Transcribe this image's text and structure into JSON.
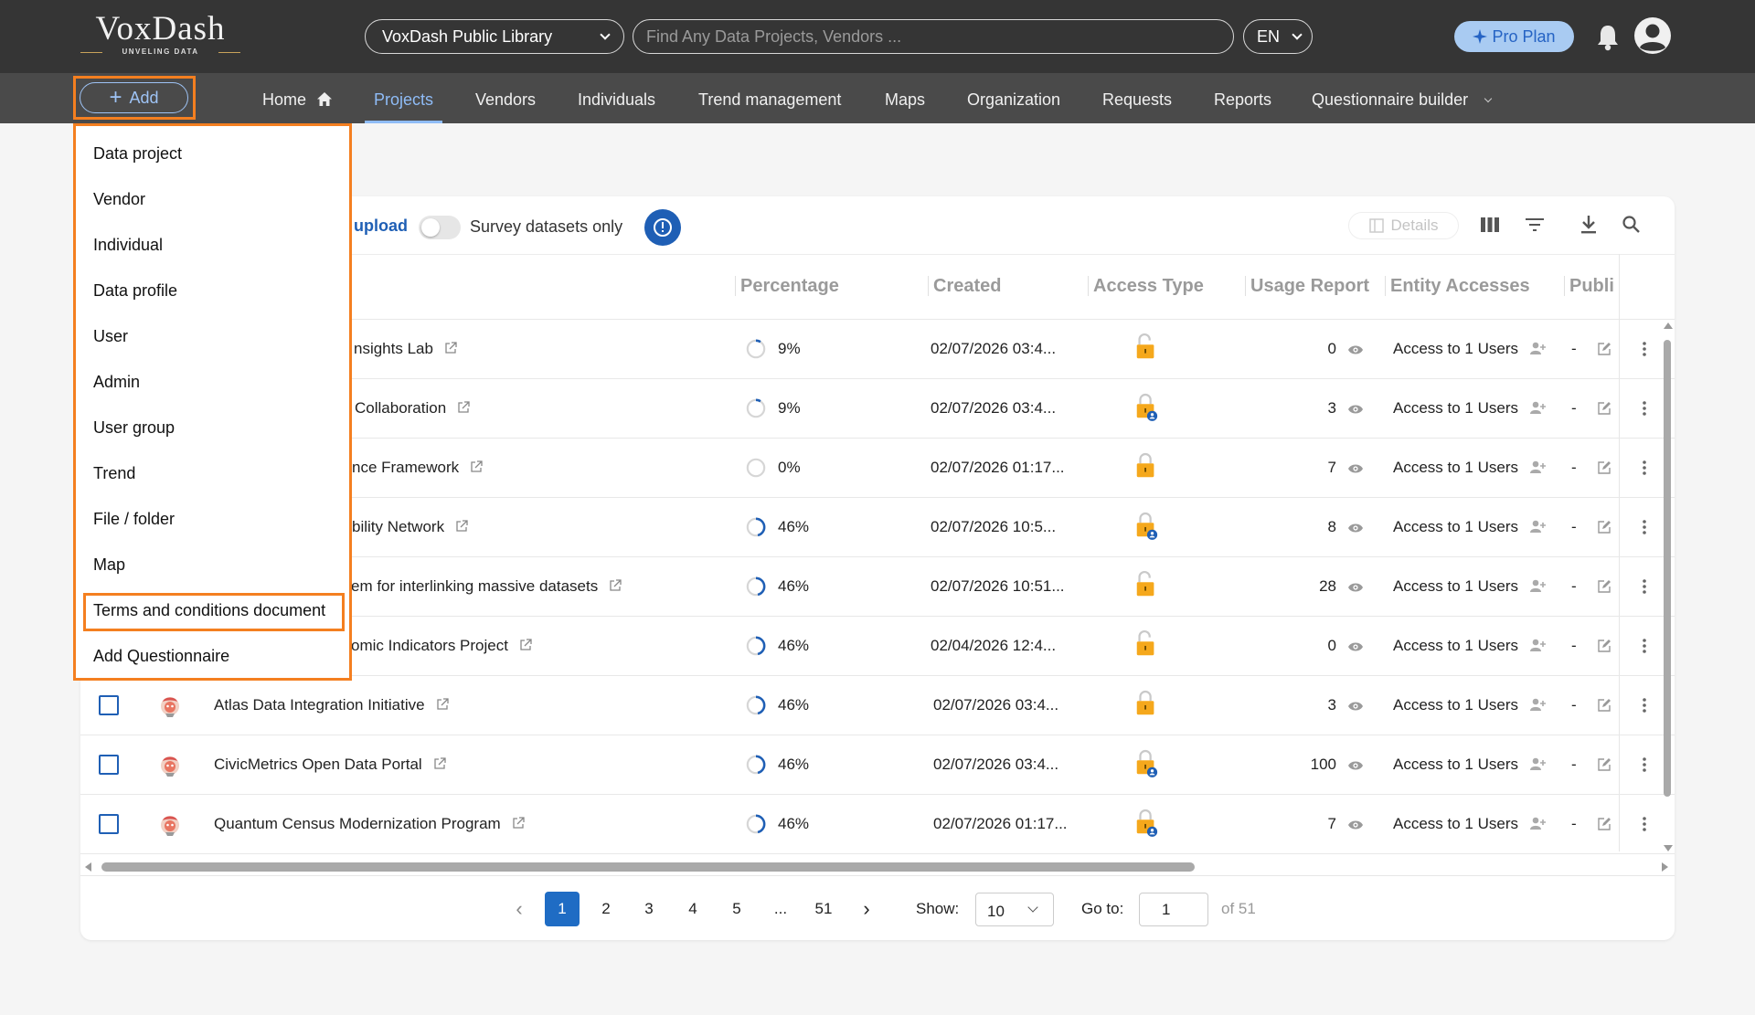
{
  "header": {
    "logo_text": "VoxDash",
    "logo_tagline": "UNVELING DATA",
    "library_select": "VoxDash Public Library",
    "search_placeholder": "Find Any Data Projects, Vendors ...",
    "language": "EN",
    "pro_plan": "Pro Plan"
  },
  "nav": {
    "add_label": "Add",
    "items": [
      "Home",
      "Projects",
      "Vendors",
      "Individuals",
      "Trend management",
      "Maps",
      "Organization",
      "Requests",
      "Reports",
      "Questionnaire builder"
    ],
    "active": "Projects"
  },
  "toolbar": {
    "upload_label": "upload",
    "survey_toggle_label": "Survey datasets only",
    "details_label": "Details"
  },
  "table": {
    "columns": [
      "Percentage",
      "Created",
      "Access Type",
      "Usage Report",
      "Entity Accesses",
      "Publi"
    ],
    "rows": [
      {
        "name": "nsights Lab",
        "percent": "9%",
        "progress": 0.09,
        "created": "02/07/2026 03:4...",
        "access": "unlocked",
        "usage": "0",
        "entity": "Access to 1 Users",
        "publi": "-"
      },
      {
        "name": "Collaboration",
        "percent": "9%",
        "progress": 0.09,
        "created": "02/07/2026 03:4...",
        "access": "locked-user",
        "usage": "3",
        "entity": "Access to 1 Users",
        "publi": "-"
      },
      {
        "name": "nce Framework",
        "percent": "0%",
        "progress": 0.0,
        "created": "02/07/2026 01:17...",
        "access": "locked",
        "usage": "7",
        "entity": "Access to 1 Users",
        "publi": "-"
      },
      {
        "name": "bility Network",
        "percent": "46%",
        "progress": 0.46,
        "created": "02/07/2026 10:5...",
        "access": "locked-user",
        "usage": "8",
        "entity": "Access to 1 Users",
        "publi": "-"
      },
      {
        "name": "em for interlinking massive datasets",
        "percent": "46%",
        "progress": 0.46,
        "created": "02/07/2026 10:51...",
        "access": "unlocked",
        "usage": "28",
        "entity": "Access to 1 Users",
        "publi": "-"
      },
      {
        "name": "omic Indicators Project",
        "percent": "46%",
        "progress": 0.46,
        "created": "02/04/2026 12:4...",
        "access": "unlocked",
        "usage": "0",
        "entity": "Access to 1 Users",
        "publi": "-"
      },
      {
        "name": "Atlas Data Integration Initiative",
        "percent": "46%",
        "progress": 0.46,
        "created": "02/07/2026 03:4...",
        "access": "locked",
        "usage": "3",
        "entity": "Access to 1 Users",
        "publi": "-"
      },
      {
        "name": "CivicMetrics Open Data Portal",
        "percent": "46%",
        "progress": 0.46,
        "created": "02/07/2026 03:4...",
        "access": "locked-user",
        "usage": "100",
        "entity": "Access to 1 Users",
        "publi": "-"
      },
      {
        "name": "Quantum Census Modernization Program",
        "percent": "46%",
        "progress": 0.46,
        "created": "02/07/2026 01:17...",
        "access": "locked-user",
        "usage": "7",
        "entity": "Access to 1 Users",
        "publi": "-"
      }
    ]
  },
  "add_menu": {
    "items": [
      "Data project",
      "Vendor",
      "Individual",
      "Data profile",
      "User",
      "Admin",
      "User group",
      "Trend",
      "File / folder",
      "Map",
      "Terms and conditions document",
      "Add Questionnaire"
    ],
    "highlighted": "Terms and conditions document"
  },
  "pagination": {
    "pages": [
      "1",
      "2",
      "3",
      "4",
      "5",
      "...",
      "51"
    ],
    "current": "1",
    "show_label": "Show:",
    "show_value": "10",
    "goto_label": "Go to:",
    "goto_value": "1",
    "of_label": "of 51"
  },
  "colors": {
    "accent": "#1f6cc4",
    "highlight": "#f47f20",
    "lock": "#f5a81c",
    "topbar": "#353535",
    "navbar": "#4a4a4a"
  }
}
